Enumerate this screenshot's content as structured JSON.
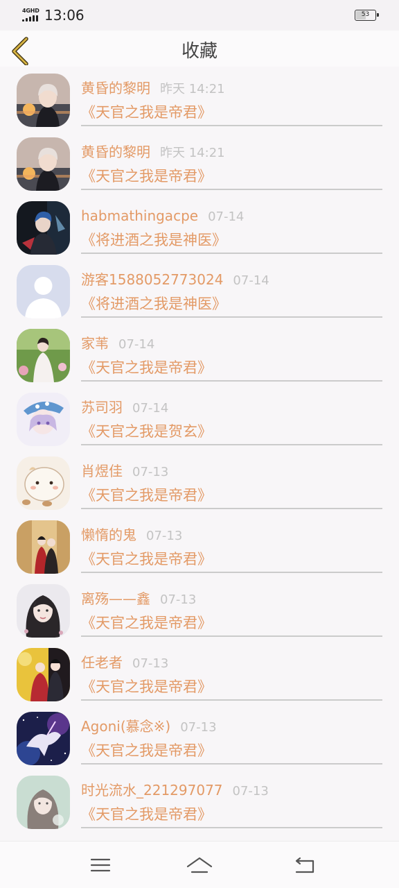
{
  "status_bar": {
    "network": "4GHD",
    "time": "13:06",
    "battery": "53",
    "battery_level_percent": 53
  },
  "header": {
    "title": "收藏",
    "back_icon": "chevron-left-icon"
  },
  "colors": {
    "accent": "#e39a66",
    "back_icon": "#c9a332",
    "timestamp": "#c3c3c3",
    "divider": "#cbcbcb"
  },
  "favorites": [
    {
      "name": "黄昏的黎明",
      "time": "昨天 14:21",
      "book": "《天官之我是帝君》",
      "avatar": "anime-boy-sunset"
    },
    {
      "name": "黄昏的黎明",
      "time": "昨天 14:21",
      "book": "《天官之我是帝君》",
      "avatar": "anime-boy-sunset"
    },
    {
      "name": "habmathingacpe",
      "time": "07-14",
      "book": "《将进酒之我是神医》",
      "avatar": "dark-fantasy-boy"
    },
    {
      "name": "游客1588052773024",
      "time": "07-14",
      "book": "《将进酒之我是神医》",
      "avatar": "default-person"
    },
    {
      "name": "家苇",
      "time": "07-14",
      "book": "《天官之我是帝君》",
      "avatar": "hanfu-girl-garden"
    },
    {
      "name": "苏司羽",
      "time": "07-14",
      "book": "《天官之我是贺玄》",
      "avatar": "anime-boy-blue-hat"
    },
    {
      "name": "肖煜佳",
      "time": "07-13",
      "book": "《天官之我是帝君》",
      "avatar": "cute-hamster"
    },
    {
      "name": "懒惰的鬼",
      "time": "07-13",
      "book": "《天官之我是帝君》",
      "avatar": "ancient-couple-red"
    },
    {
      "name": "离殇——鑫",
      "time": "07-13",
      "book": "《天官之我是帝君》",
      "avatar": "girl-portrait"
    },
    {
      "name": "任老者",
      "time": "07-13",
      "book": "《天官之我是帝君》",
      "avatar": "anime-couple-yellow"
    },
    {
      "name": "Agoni(慕念※)",
      "time": "07-13",
      "book": "《天官之我是帝君》",
      "avatar": "galaxy-unicorn"
    },
    {
      "name": "时光流水_221297077",
      "time": "07-13",
      "book": "《天官之我是帝君》",
      "avatar": "girl-soft-green"
    }
  ],
  "nav_bar": {
    "menu_icon": "menu-icon",
    "home_icon": "home-icon",
    "back_icon": "return-icon"
  }
}
